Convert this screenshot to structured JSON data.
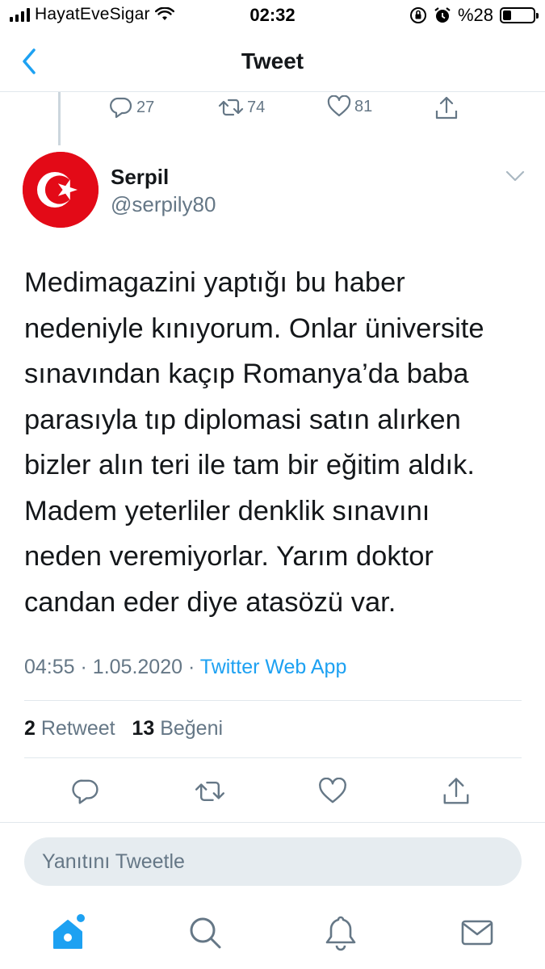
{
  "status_bar": {
    "carrier": "HayatEveSigar",
    "time": "02:32",
    "battery_text": "%28",
    "battery_level": 0.28,
    "icons": [
      "signal-icon",
      "wifi-icon",
      "orientation-lock-icon",
      "alarm-icon",
      "battery-icon"
    ]
  },
  "nav": {
    "title": "Tweet",
    "back_icon": "chevron-left-icon"
  },
  "previous_tweet_actions": {
    "replies": "27",
    "retweets": "74",
    "likes": "81"
  },
  "tweet": {
    "display_name": "Serpil",
    "handle": "@serpily80",
    "text": "Medimagazini yaptığı bu haber\nnedeniyle kınıyorum. Onlar üniversite\nsınavından kaçıp Romanya’da baba\nparasıyla tıp diplomasi satın alırken\nbizler alın teri ile tam bir eğitim aldık.\nMadem yeterliler denklik sınavını\nneden veremiyorlar. Yarım doktor\ncandan eder diye atasözü var.",
    "time": "04:55",
    "date": "1.05.2020",
    "separator": "·",
    "source": "Twitter Web App",
    "retweet_count": "2",
    "retweet_label": "Retweet",
    "like_count": "13",
    "like_label": "Beğeni"
  },
  "reply_box": {
    "placeholder": "Yanıtını Tweetle"
  },
  "tab_bar": {
    "items": [
      "home-icon",
      "search-icon",
      "notifications-icon",
      "messages-icon"
    ]
  },
  "colors": {
    "accent": "#1da1f2",
    "secondary_text": "#657786",
    "flag_red": "#e30a17"
  }
}
